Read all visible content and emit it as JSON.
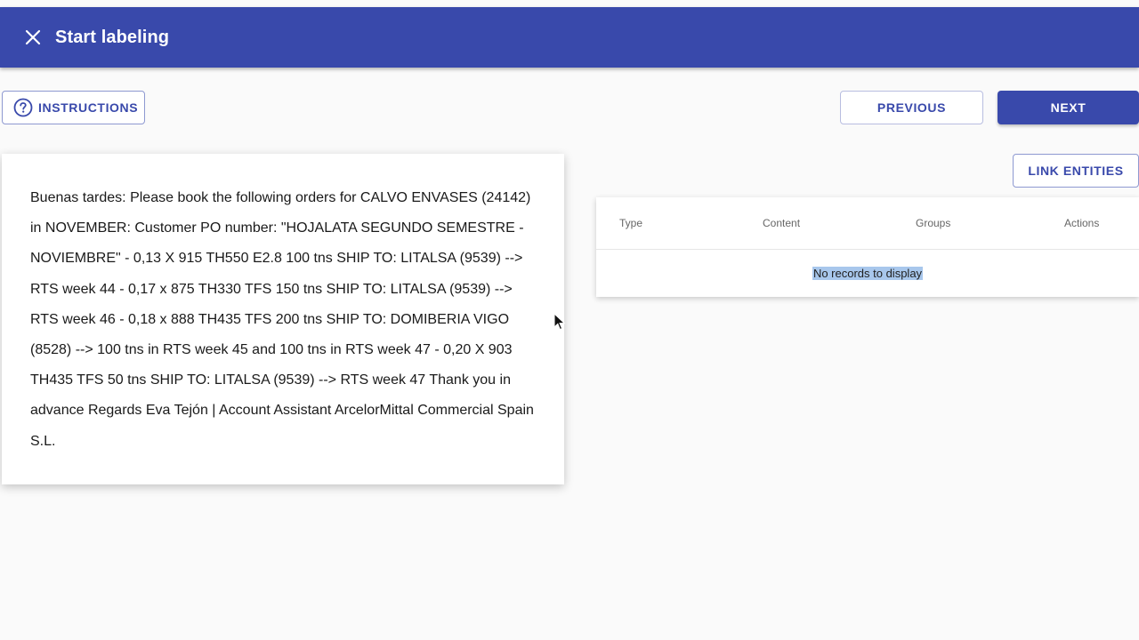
{
  "appbar": {
    "title": "Start labeling",
    "close_icon": "close-icon",
    "color": "#3949ab"
  },
  "toolbar": {
    "instructions_label": "INSTRUCTIONS",
    "instructions_icon": "help-circle-icon",
    "previous_label": "PREVIOUS",
    "next_label": "NEXT"
  },
  "document": {
    "text": "Buenas tardes: Please book the following orders for CALVO ENVASES (24142) in NOVEMBER: Customer PO number: \"HOJALATA SEGUNDO SEMESTRE - NOVIEMBRE\" - 0,13 X 915 TH550 E2.8 100 tns SHIP TO: LITALSA (9539) --> RTS week 44 - 0,17 x 875 TH330 TFS 150 tns SHIP TO: LITALSA (9539) --> RTS week 46 - 0,18 x 888 TH435 TFS 200 tns SHIP TO: DOMIBERIA VIGO (8528) --> 100 tns in RTS week 45 and 100 tns in RTS week 47 - 0,20 X 903 TH435 TFS 50 tns SHIP TO: LITALSA (9539) --> RTS week 47 Thank you in advance Regards Eva Tejón | Account Assistant ArcelorMittal Commercial Spain S.L."
  },
  "entities": {
    "link_label": "LINK ENTITIES",
    "columns": [
      "Type",
      "Content",
      "Groups",
      "Actions"
    ],
    "empty_message": "No records to display"
  }
}
